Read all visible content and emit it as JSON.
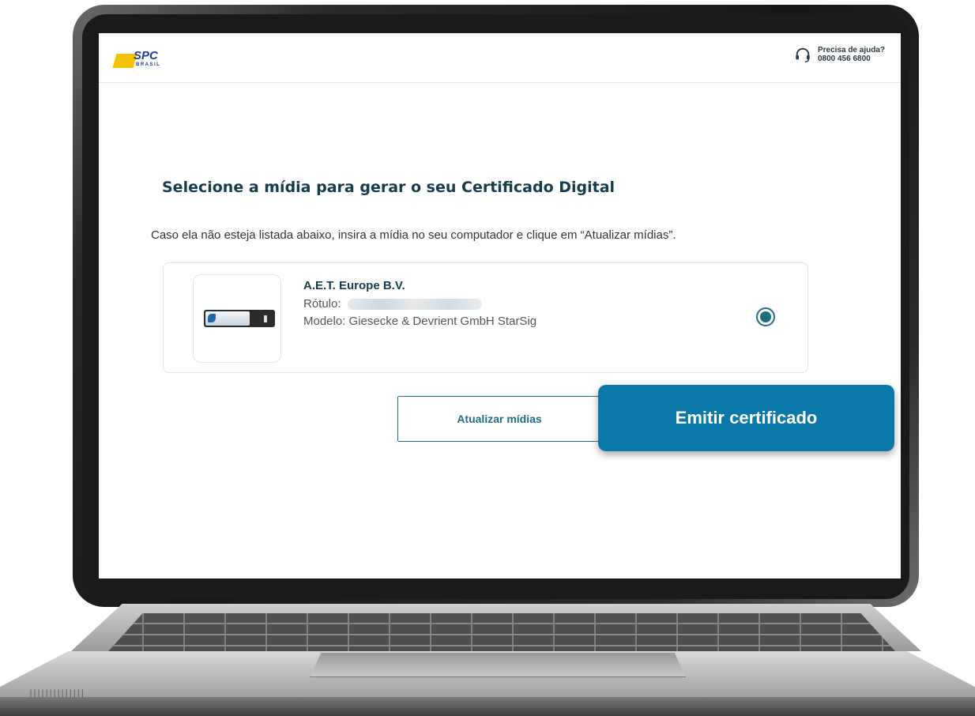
{
  "header": {
    "logo_text": "SPC",
    "logo_subtext": "BRASIL",
    "help_title": "Precisa de ajuda?",
    "help_phone": "0800 456 6800"
  },
  "main": {
    "title": "Selecione a mídia para gerar o seu Certificado Digital",
    "subtitle": "Caso ela não esteja listada abaixo, insira a mídia no seu computador e clique em “Atualizar mídias”."
  },
  "media": {
    "vendor": "A.E.T. Europe B.V.",
    "label_key": "Rótulo:",
    "model": "Modelo: Giesecke & Devrient GmbH StarSig",
    "selected": true
  },
  "actions": {
    "update_label": "Atualizar mídias",
    "issue_label": "Emitir certificado"
  },
  "colors": {
    "primary": "#0b78aa",
    "heading": "#153c4a",
    "radio": "#1f6e80",
    "logo_yellow": "#f4c400",
    "logo_blue": "#1c3f95"
  },
  "icons": {
    "help": "headset-icon",
    "media": "usb-token-icon",
    "radio": "radio-selected-icon"
  }
}
